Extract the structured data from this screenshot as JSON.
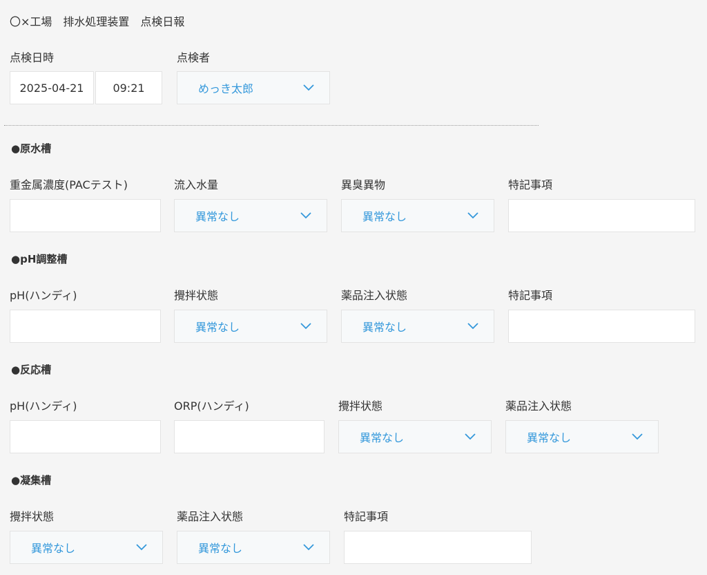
{
  "header": {
    "title": "〇×工場　排水処理装置　点検日報"
  },
  "inspection": {
    "datetime_label": "点検日時",
    "date_value": "2025-04-21",
    "time_value": "09:21",
    "inspector_label": "点検者",
    "inspector_value": "めっき太郎"
  },
  "sections": {
    "raw_water": {
      "title": "●原水槽",
      "heavy_metal_label": "重金属濃度(PACテスト)",
      "inflow_label": "流入水量",
      "inflow_value": "異常なし",
      "odor_label": "異臭異物",
      "odor_value": "異常なし",
      "notes_label": "特記事項"
    },
    "ph_adjust": {
      "title": "●pH調整槽",
      "ph_label": "pH(ハンディ)",
      "stir_label": "攪拌状態",
      "stir_value": "異常なし",
      "chem_label": "薬品注入状態",
      "chem_value": "異常なし",
      "notes_label": "特記事項"
    },
    "reaction": {
      "title": "●反応槽",
      "ph_label": "pH(ハンディ)",
      "orp_label": "ORP(ハンディ)",
      "stir_label": "攪拌状態",
      "stir_value": "異常なし",
      "chem_label": "薬品注入状態",
      "chem_value": "異常なし"
    },
    "coagulation": {
      "title": "●凝集槽",
      "stir_label": "攪拌状態",
      "stir_value": "異常なし",
      "chem_label": "薬品注入状態",
      "chem_value": "異常なし",
      "notes_label": "特記事項"
    }
  },
  "colors": {
    "select_text": "#3498db",
    "background": "#f5f5f5",
    "input_border": "#e3e3e3"
  },
  "icons": {
    "dropdown": "chevron-down-icon"
  }
}
